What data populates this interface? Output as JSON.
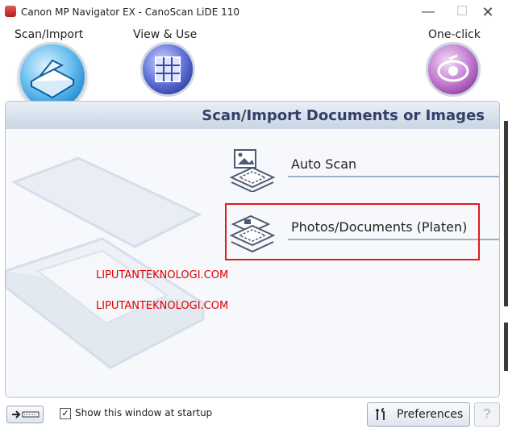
{
  "window": {
    "title": "Canon MP Navigator EX - CanoScan LiDE 110",
    "minimize_glyph": "—",
    "maximize_glyph": "☐",
    "close_glyph": "✕"
  },
  "modes": {
    "scan_import": "Scan/Import",
    "view_use": "View & Use",
    "one_click": "One-click"
  },
  "panel": {
    "title": "Scan/Import Documents or Images",
    "actions": {
      "auto_scan": "Auto Scan",
      "photos_documents": "Photos/Documents (Platen)"
    }
  },
  "watermarks": [
    "LIPUTANTEKNOLOGI.COM",
    "LIPUTANTEKNOLOGI.COM"
  ],
  "footer": {
    "show_at_startup_label": "Show this window at startup",
    "show_at_startup_checked": "✓",
    "preferences_label": "Preferences",
    "help_label": "?"
  },
  "icons": {
    "app": "app-icon",
    "scan_mode": "scanner-icon",
    "view_mode": "photo-grid-icon",
    "one_click_mode": "one-click-icon",
    "auto_scan": "auto-scan-icon",
    "platen": "platen-icon",
    "mode_switch": "mode-switch-icon",
    "preferences": "preferences-icon"
  },
  "colors": {
    "highlight_border": "#dd1c1c",
    "panel_title": "#30406a",
    "watermark": "#e00000"
  }
}
